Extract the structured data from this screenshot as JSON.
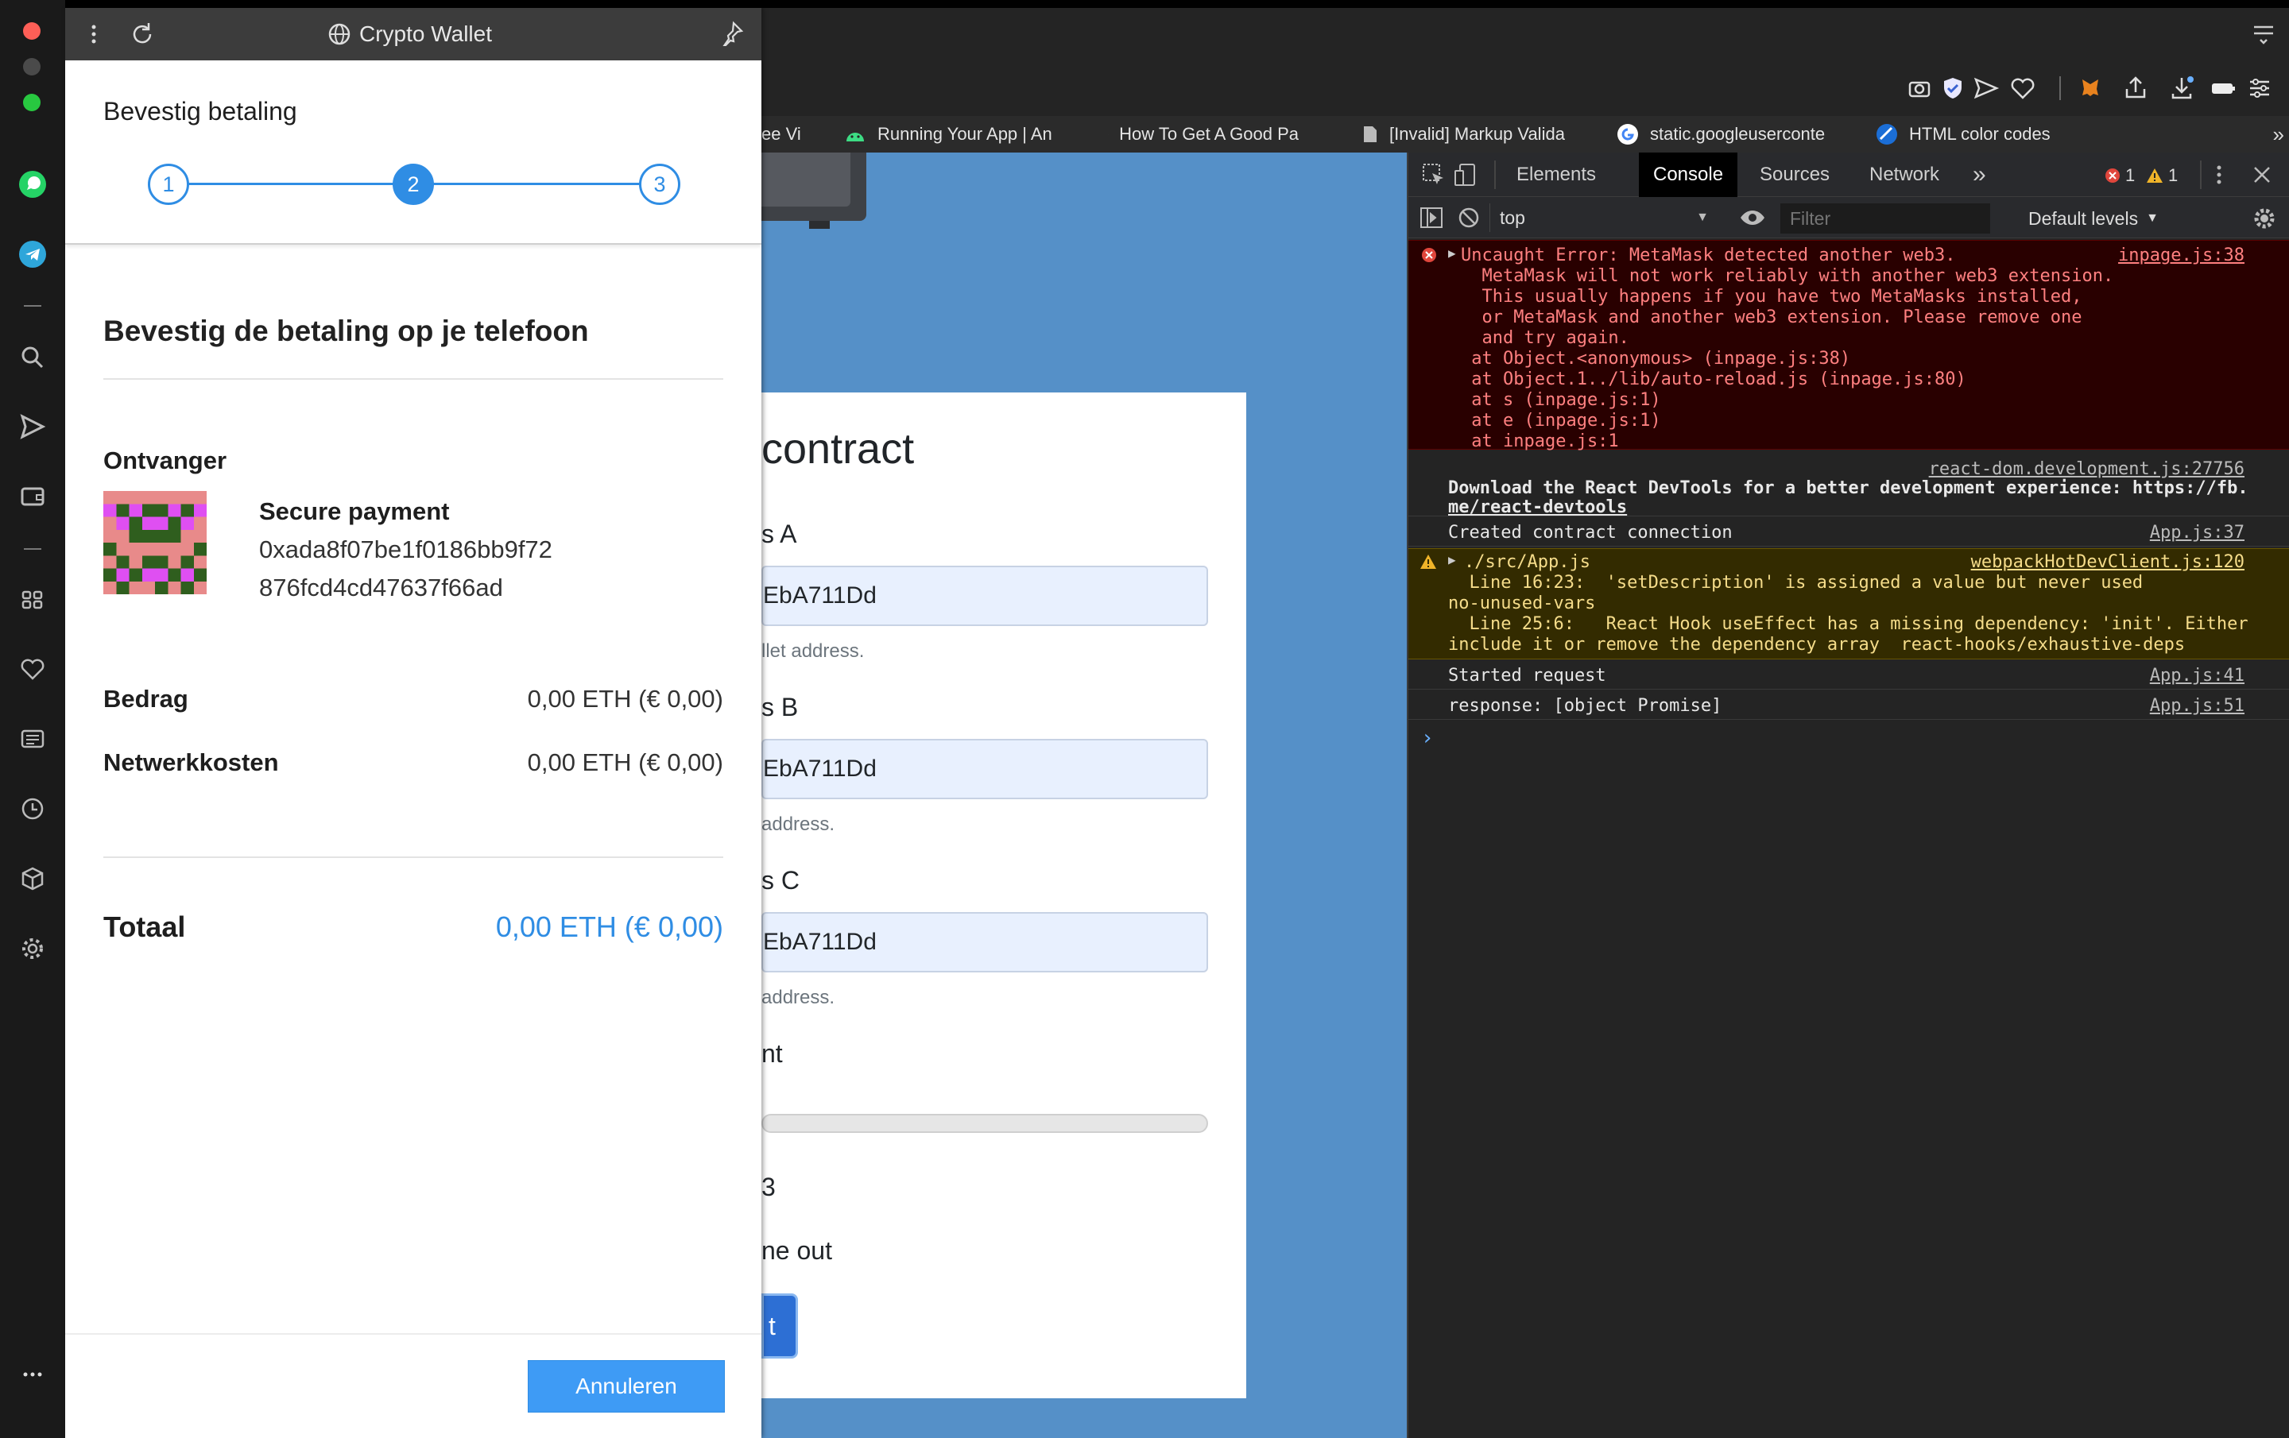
{
  "wallet": {
    "title": "Crypto Wallet",
    "header_title": "Bevestig betaling",
    "steps": [
      "1",
      "2",
      "3"
    ],
    "active_step": 2,
    "confirm_heading": "Bevestig de betaling op je telefoon",
    "recipient_label": "Ontvanger",
    "recipient_name": "Secure payment",
    "recipient_address_line1": "0xada8f07be1f0186bb9f72",
    "recipient_address_line2": "876fcd4cd47637f66ad",
    "amount_label": "Bedrag",
    "amount_value": "0,00 ETH (€ 0,00)",
    "fee_label": "Netwerkkosten",
    "fee_value": "0,00 ETH (€ 0,00)",
    "total_label": "Totaal",
    "total_value": "0,00 ETH (€ 0,00)",
    "cancel_button": "Annuleren",
    "accent_color": "#2f8de4"
  },
  "bookmarks": [
    {
      "label": "ee Vi",
      "icon": "none"
    },
    {
      "label": "Running Your App | An",
      "icon": "android-icon"
    },
    {
      "label": "How To Get A Good Pa",
      "icon": "page-icon"
    },
    {
      "label": "[Invalid] Markup Valida",
      "icon": "page-icon"
    },
    {
      "label": "static.googleuserconte",
      "icon": "google-icon"
    },
    {
      "label": "HTML color codes",
      "icon": "htmlcolor-icon"
    }
  ],
  "page": {
    "title_fragment": "contract",
    "label_a": "s A",
    "value_a": "EbA711Dd",
    "help_a": "llet address.",
    "label_b": "s B",
    "value_b": "EbA711Dd",
    "help_b": "address.",
    "label_c": "s C",
    "value_c": "EbA711Dd",
    "help_c": "address.",
    "label_d": "nt",
    "label_e": "3",
    "label_f": "ne out",
    "button_fragment": "t",
    "background_color": "#5590c8"
  },
  "devtools": {
    "tabs": [
      "Elements",
      "Console",
      "Sources",
      "Network"
    ],
    "active_tab": "Console",
    "more_tabs": "»",
    "error_count": "1",
    "warning_count": "1",
    "context": "top",
    "filter_placeholder": "Filter",
    "levels": "Default levels",
    "logs": {
      "error_lines": [
        "Uncaught Error: MetaMask detected another web3.",
        "  MetaMask will not work reliably with another web3 extension.",
        "  This usually happens if you have two MetaMasks installed,",
        "  or MetaMask and another web3 extension. Please remove one",
        "  and try again.",
        " at Object.<anonymous> (inpage.js:38)",
        " at Object.1../lib/auto-reload.js (inpage.js:80)",
        " at s (inpage.js:1)",
        " at e (inpage.js:1)",
        " at inpage.js:1"
      ],
      "error_source": "inpage.js:38",
      "react_source": "react-dom.development.js:27756",
      "react_line1": "Download the React DevTools for a better development experience: https://fb.",
      "react_line2": "me/react-devtools",
      "created_text": "Created contract connection",
      "created_source": "App.js:37",
      "warn_lines": [
        "./src/App.js",
        "  Line 16:23:  'setDescription' is assigned a value but never used",
        "no-unused-vars",
        "  Line 25:6:   React Hook useEffect has a missing dependency: 'init'. Either",
        "include it or remove the dependency array  react-hooks/exhaustive-deps"
      ],
      "warn_source": "webpackHotDevClient.js:120",
      "started_text": "Started request",
      "started_source": "App.js:41",
      "response_text": "response: [object Promise]",
      "response_source": "App.js:51",
      "prompt": "›"
    }
  }
}
